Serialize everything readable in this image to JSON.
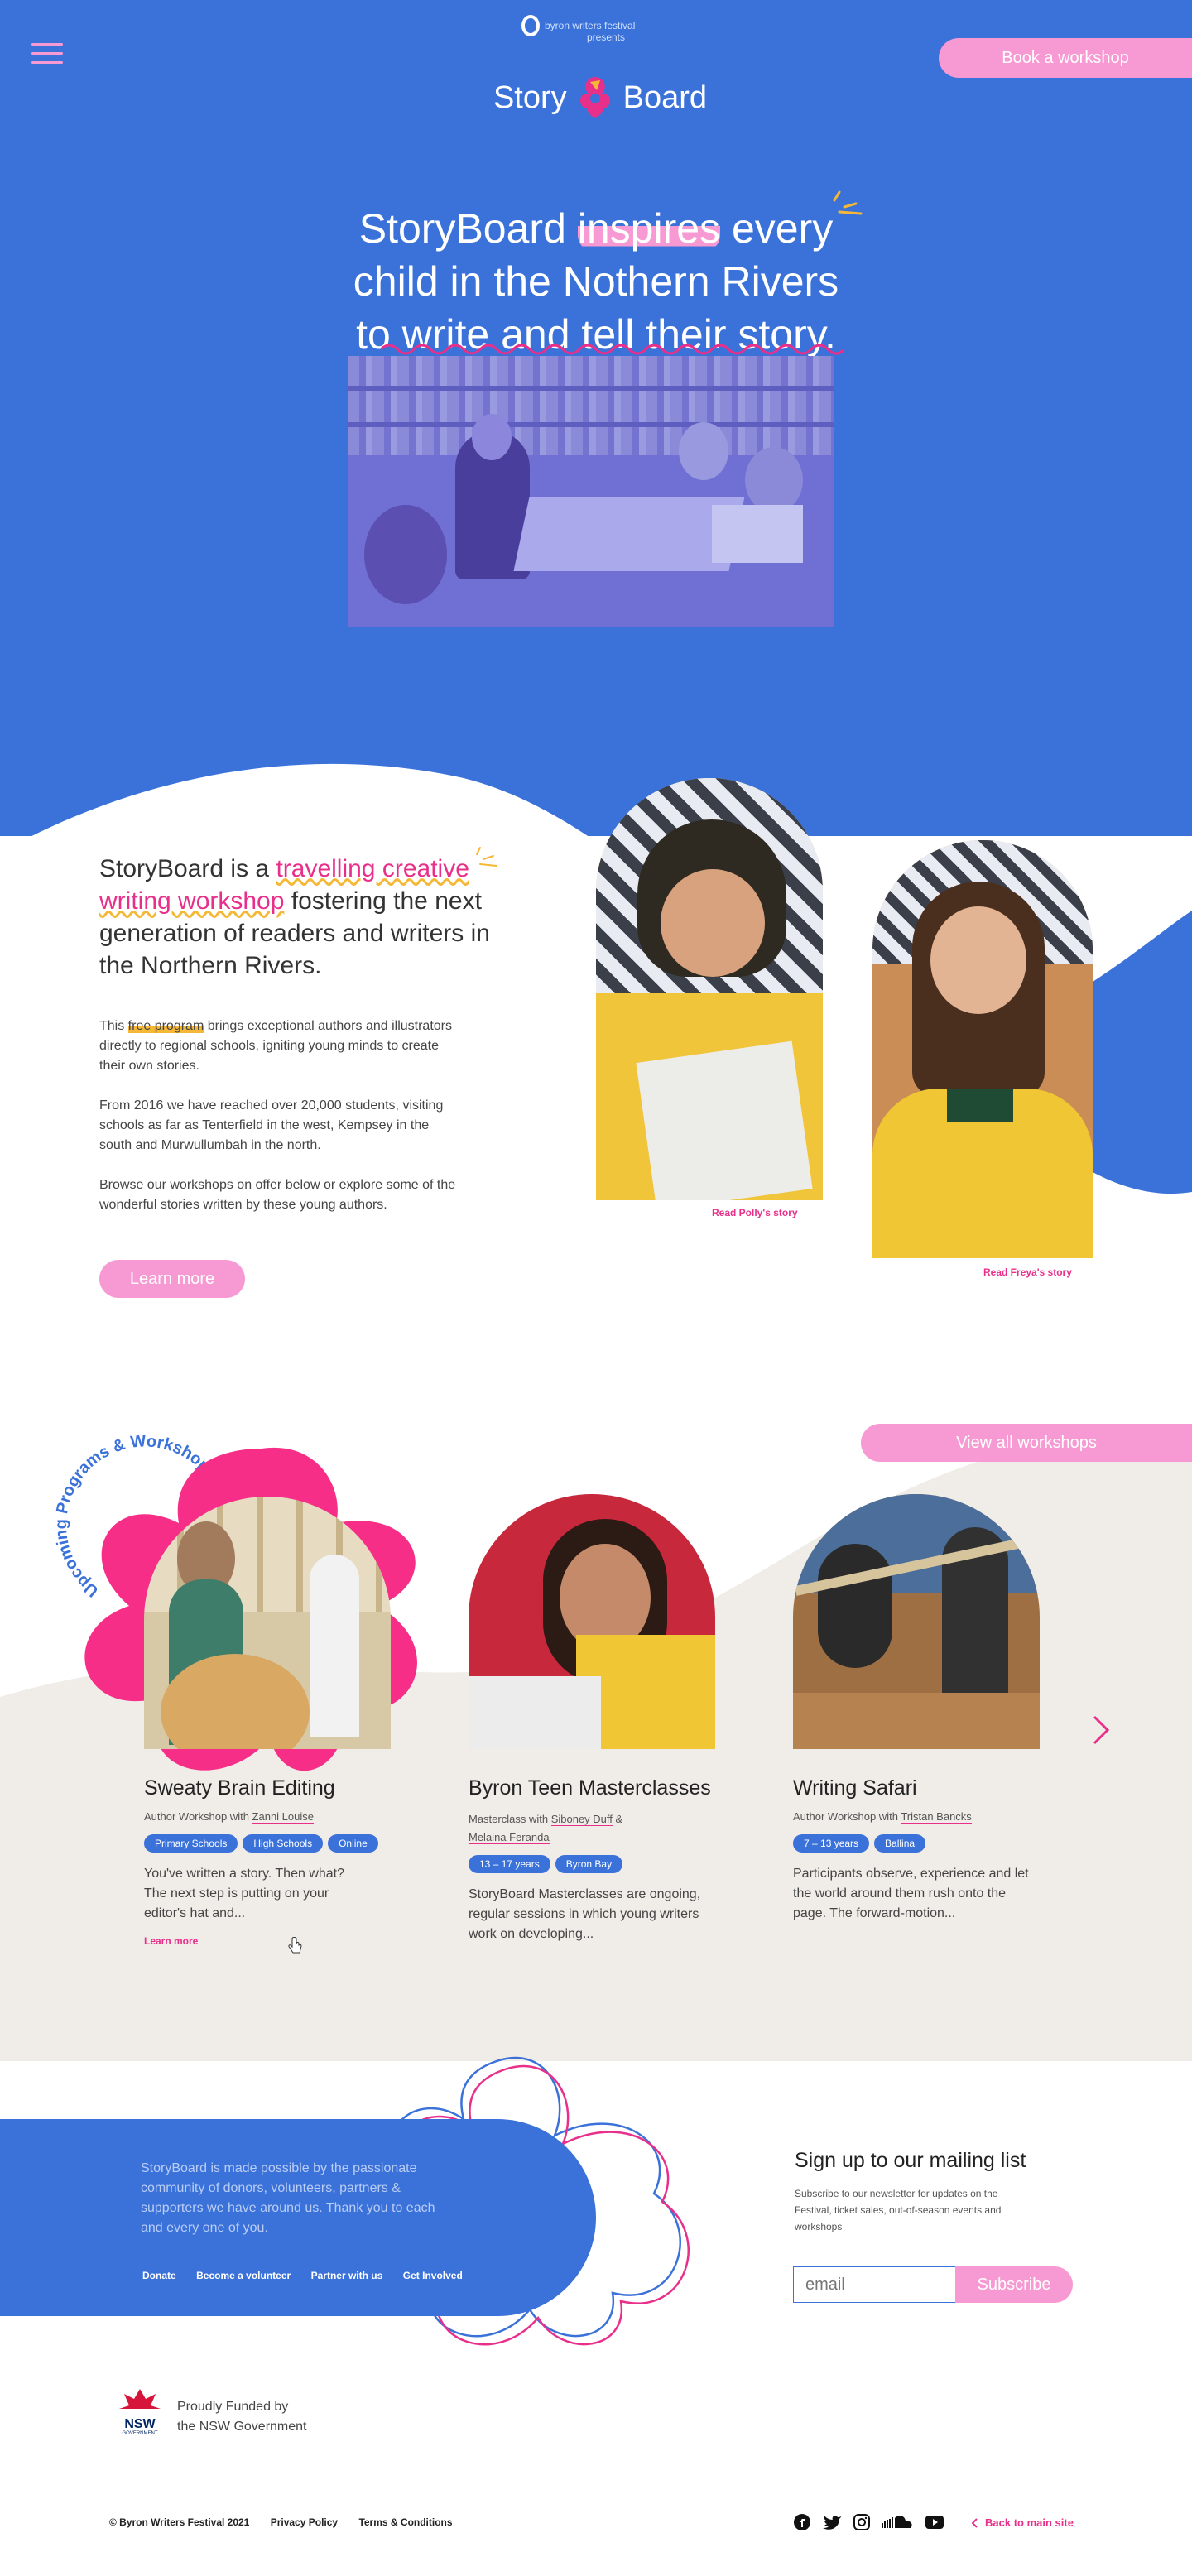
{
  "header": {
    "festival_name": "byron writers festival",
    "presents": "presents",
    "logo_left": "Story",
    "logo_right": "Board",
    "book_button": "Book a workshop",
    "menu_icon": "hamburger-menu-icon"
  },
  "hero": {
    "line1_a": "StoryBoard ",
    "line1_hl": "inspires",
    "line1_b": " every",
    "line2": "child in the Nothern Rivers",
    "line3": "to write and tell their story."
  },
  "about": {
    "heading_a": "StoryBoard is a ",
    "heading_hl": "travelling creative writing workshop",
    "heading_b": " fostering the next generation of readers and writers in the Northern Rivers.",
    "p1_a": "This ",
    "p1_hl": "free program",
    "p1_b": " brings exceptional authors and illustrators directly to regional schools, igniting young minds to create their own stories.",
    "p2": "From 2016 we have reached over 20,000 students, visiting schools as far as Tenterfield in the west, Kempsey in the south and Murwullumbah in the north.",
    "p3": "Browse our workshops on offer below or explore some of the wonderful stories written by these young authors.",
    "learn_more": "Learn more",
    "story1_link": "Read Polly's story",
    "story2_link": "Read Freya's story"
  },
  "workshops": {
    "section_title": "Upcoming Programs & Workshops",
    "view_all": "View all workshops",
    "next_icon": "chevron-right-icon",
    "items": [
      {
        "title": "Sweaty Brain Editing",
        "type": "Author Workshop with ",
        "authors": [
          "Zanni Louise"
        ],
        "tags": [
          "Primary Schools",
          "High Schools",
          "Online"
        ],
        "desc": "You've written a story. Then what? The next step is putting on your editor's hat and...",
        "link": "Learn more"
      },
      {
        "title": "Byron Teen Masterclasses",
        "type": "Masterclass with ",
        "authors": [
          "Siboney Duff",
          "Melaina Feranda"
        ],
        "joiner": " &",
        "tags": [
          "13 – 17 years",
          "Byron Bay"
        ],
        "desc": "StoryBoard Masterclasses are ongoing, regular sessions in which young writers work on developing..."
      },
      {
        "title": "Writing Safari",
        "type": "Author Workshop with ",
        "authors": [
          "Tristan Bancks"
        ],
        "tags": [
          "7 – 13 years",
          "Ballina"
        ],
        "desc": "Participants observe, experience and let the world around them rush onto the page. The forward-motion..."
      }
    ]
  },
  "support": {
    "text": "StoryBoard is made possible by the passionate community of donors, volunteers, partners & supporters we have around us. Thank you to each and every one of you.",
    "links": [
      "Donate",
      "Become a volunteer",
      "Partner with us",
      "Get Involved"
    ]
  },
  "mailing": {
    "title": "Sign up to our mailing list",
    "desc": "Subscribe to our newsletter for updates on the Festival, ticket sales, out-of-season events and workshops",
    "placeholder": "email",
    "button": "Subscribe"
  },
  "funding": {
    "nsw": "NSW",
    "gov": "GOVERNMENT",
    "line1": "Proudly Funded by",
    "line2": "the NSW Government"
  },
  "footer": {
    "copyright": "© Byron Writers Festival 2021",
    "privacy": "Privacy Policy",
    "terms": "Terms & Conditions",
    "back": "Back to main site",
    "social": [
      "facebook-icon",
      "twitter-icon",
      "instagram-icon",
      "soundcloud-icon",
      "youtube-icon"
    ]
  },
  "colors": {
    "blue": "#3b72da",
    "pink": "#f79ad3",
    "magenta": "#e8308b",
    "beige": "#f0ece7",
    "yellow": "#f5b836"
  }
}
